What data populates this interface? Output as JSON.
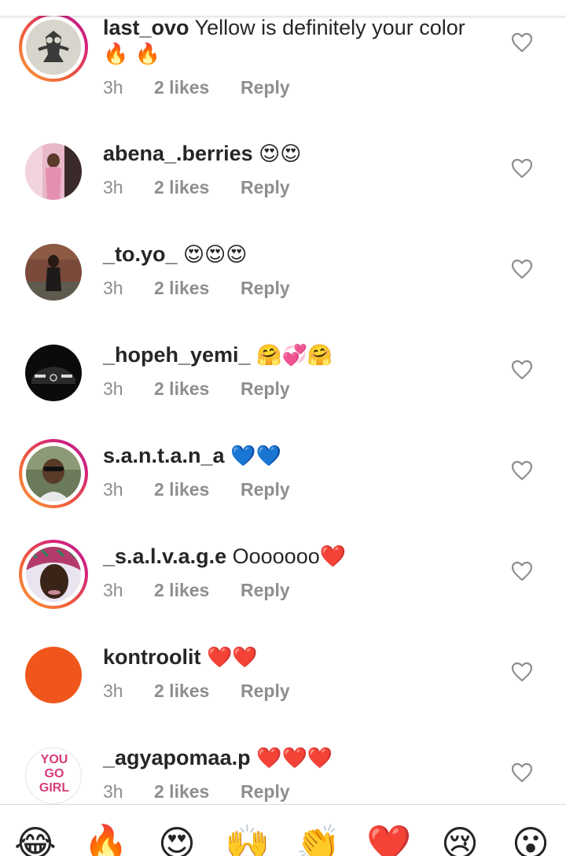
{
  "comments": [
    {
      "username": "last_ovo",
      "text": "Yellow is definitely your color",
      "emoji_line2": "🔥 🔥",
      "time": "3h",
      "likes": "2 likes",
      "reply": "Reply",
      "ring": true,
      "avatar": "owl"
    },
    {
      "username": "abena_.berries",
      "text": "😍😍",
      "time": "3h",
      "likes": "2 likes",
      "reply": "Reply",
      "ring": false,
      "avatar": "pink"
    },
    {
      "username": "_to.yo_",
      "text": "😍😍😍",
      "time": "3h",
      "likes": "2 likes",
      "reply": "Reply",
      "ring": false,
      "avatar": "brick"
    },
    {
      "username": "_hopeh_yemi_",
      "text": "🤗💞🤗",
      "time": "3h",
      "likes": "2 likes",
      "reply": "Reply",
      "ring": false,
      "avatar": "car"
    },
    {
      "username": "s.a.n.t.a.n_a",
      "text": "💙💙",
      "time": "3h",
      "likes": "2 likes",
      "reply": "Reply",
      "ring": true,
      "avatar": "glasses"
    },
    {
      "username": "_s.a.l.v.a.g.e",
      "text": "Ooooooo❤️",
      "time": "3h",
      "likes": "2 likes",
      "reply": "Reply",
      "ring": true,
      "avatar": "face"
    },
    {
      "username": "kontroolit",
      "text": "❤️❤️",
      "time": "3h",
      "likes": "2 likes",
      "reply": "Reply",
      "ring": false,
      "avatar": "orange"
    },
    {
      "username": "_agyapomaa.p",
      "text": "❤️❤️❤️",
      "time": "3h",
      "likes": "2 likes",
      "reply": "Reply",
      "ring": false,
      "avatar": "yougogirl"
    }
  ],
  "avatar_text": {
    "yougogirl": "YOU GO GIRL"
  },
  "reactions": [
    "😂",
    "🔥",
    "😍",
    "🙌",
    "👏",
    "❤️",
    "😢",
    "😮"
  ],
  "colors": {
    "username": "#262626",
    "meta": "#8e8e8e",
    "accent_ring_start": "#f9a03a",
    "accent_ring_end": "#b8238f",
    "orange_avatar": "#f0561c"
  }
}
